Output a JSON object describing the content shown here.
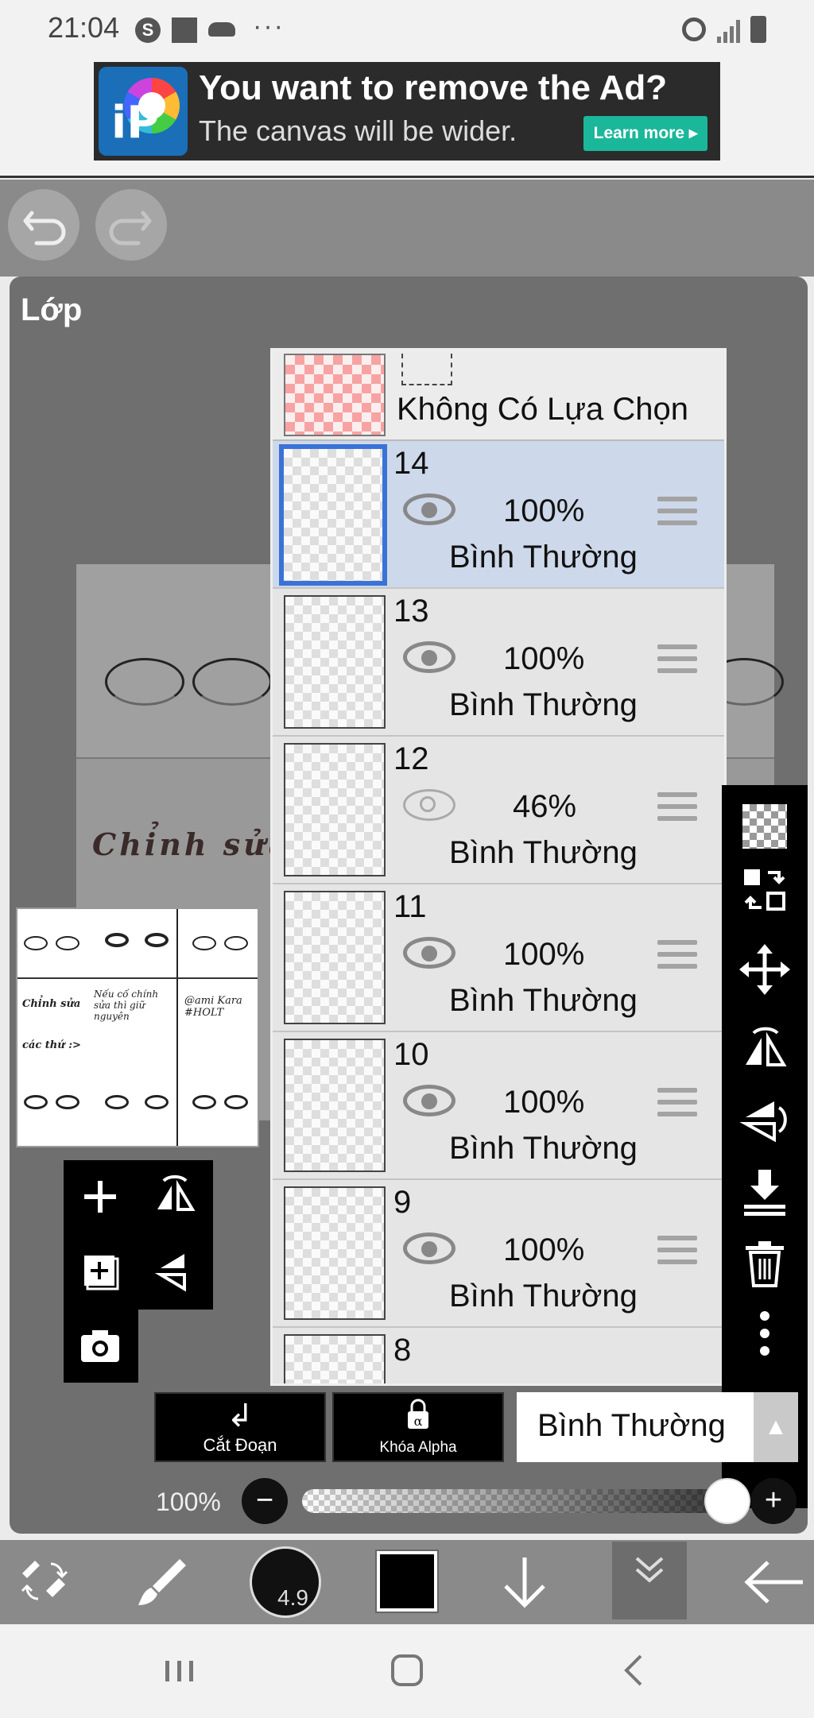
{
  "status_bar": {
    "time": "21:04",
    "s_badge": "S",
    "more": "···"
  },
  "ad": {
    "logo_text": "iP",
    "title": "You want to remove the Ad?",
    "subtitle": "The canvas will be wider.",
    "button": "Learn more ▸"
  },
  "panel": {
    "title": "Lớp",
    "canvas_text": "Chỉnh sửa"
  },
  "thumbnail_texts": {
    "a": "Chỉnh sửa",
    "b": "các thứ :>",
    "c": "Nếu cố chính sửa thì giữ nguyên",
    "d": "@ami Kara #HOLT"
  },
  "selection_row": {
    "label": "Không Có Lựa Chọn"
  },
  "layers": [
    {
      "number": "14",
      "opacity": "100%",
      "blend": "Bình Thường",
      "active": true
    },
    {
      "number": "13",
      "opacity": "100%",
      "blend": "Bình Thường"
    },
    {
      "number": "12",
      "opacity": "46%",
      "blend": "Bình Thường"
    },
    {
      "number": "11",
      "opacity": "100%",
      "blend": "Bình Thường"
    },
    {
      "number": "10",
      "opacity": "100%",
      "blend": "Bình Thường"
    },
    {
      "number": "9",
      "opacity": "100%",
      "blend": "Bình Thường"
    },
    {
      "number": "8"
    }
  ],
  "actions": {
    "clipping": "Cắt Đoạn",
    "alpha_lock": "Khóa Alpha",
    "blend_mode": "Bình Thường"
  },
  "opacity": {
    "label": "100%",
    "value": 1.0
  },
  "brush": {
    "size": "4.9"
  },
  "icons": {
    "undo": "undo-icon",
    "redo": "redo-icon",
    "add": "plus-icon",
    "camera": "camera-icon",
    "trash": "trash-icon",
    "more": "more-vertical-icon"
  }
}
